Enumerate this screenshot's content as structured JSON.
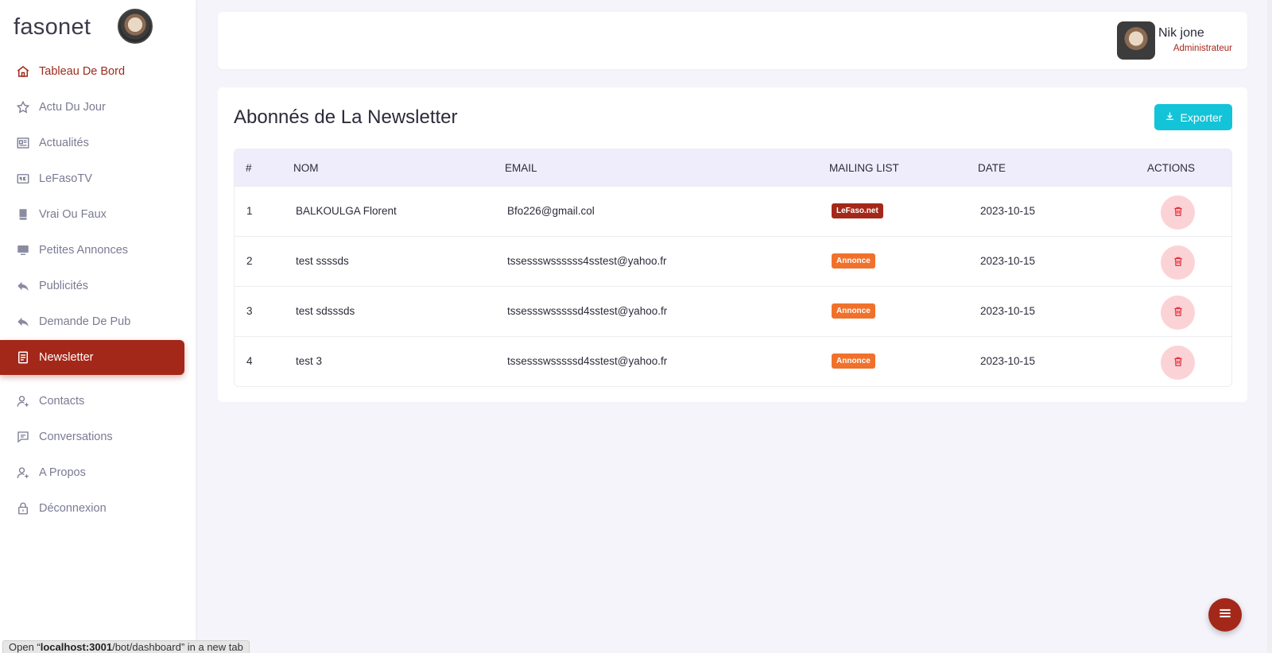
{
  "brand": {
    "name": "fasonet"
  },
  "sidebar": {
    "items": [
      {
        "label": "Tableau De Bord",
        "icon": "home-icon"
      },
      {
        "label": "Actu Du Jour",
        "icon": "star-icon"
      },
      {
        "label": "Actualités",
        "icon": "newspaper-icon"
      },
      {
        "label": "LeFasoTV",
        "icon": "tv-4k-icon"
      },
      {
        "label": "Vrai Ou Faux",
        "icon": "book-icon"
      },
      {
        "label": "Petites Annonces",
        "icon": "monitor-icon"
      },
      {
        "label": "Publicités",
        "icon": "reply-icon"
      },
      {
        "label": "Demande De Pub",
        "icon": "reply-icon"
      },
      {
        "label": "Newsletter",
        "icon": "document-icon"
      },
      {
        "label": "Contacts",
        "icon": "user-plus-icon"
      },
      {
        "label": "Conversations",
        "icon": "message-icon"
      },
      {
        "label": "A Propos",
        "icon": "user-plus-icon"
      },
      {
        "label": "Déconnexion",
        "icon": "lock-icon"
      }
    ]
  },
  "header": {
    "user_name": "Nik jone",
    "user_role": "Administrateur"
  },
  "main": {
    "title": "Abonnés de La Newsletter",
    "export_label": "Exporter",
    "table": {
      "columns": [
        "#",
        "NOM",
        "EMAIL",
        "MAILING LIST",
        "DATE",
        "ACTIONS"
      ],
      "rows": [
        {
          "num": "1",
          "nom": "BALKOULGA Florent",
          "email": "Bfo226@gmail.col",
          "list": "LeFaso.net",
          "date": "2023-10-15"
        },
        {
          "num": "2",
          "nom": "test ssssds",
          "email": "tssessswssssss4sstest@yahoo.fr",
          "list": "Annonce",
          "date": "2023-10-15"
        },
        {
          "num": "3",
          "nom": "test sdsssds",
          "email": "tssessswsssssd4sstest@yahoo.fr",
          "list": "Annonce",
          "date": "2023-10-15"
        },
        {
          "num": "4",
          "nom": "test 3",
          "email": "tssessswsssssd4sstest@yahoo.fr",
          "list": "Annonce",
          "date": "2023-10-15"
        }
      ]
    }
  },
  "statusbar": {
    "prefix": "Open “",
    "host": "localhost:3001",
    "path": "/bot/dashboard",
    "suffix": "” in a new tab"
  },
  "colors": {
    "accent": "#a3281a",
    "export": "#13c4d8",
    "badge_annonce": "#f0712b"
  }
}
